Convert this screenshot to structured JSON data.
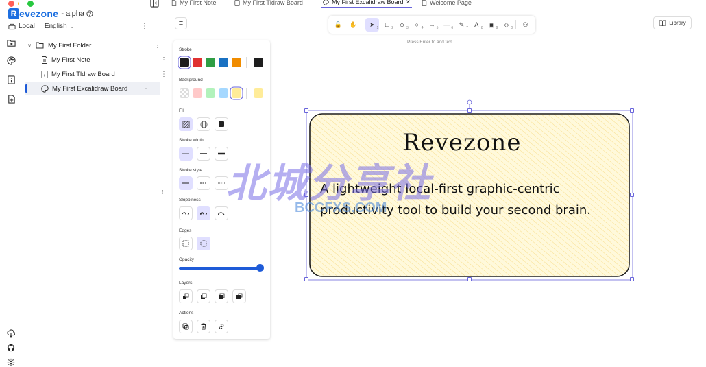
{
  "app": {
    "logo_letter": "R",
    "name": "evezone",
    "badge": "- alpha",
    "storage": "Local",
    "language": "English"
  },
  "sidebar": {
    "folder": "My First Folder",
    "items": [
      {
        "label": "My First Note",
        "icon": "note-icon"
      },
      {
        "label": "My First Tldraw Board",
        "icon": "board-icon"
      },
      {
        "label": "My First Excalidraw Board",
        "icon": "palette-icon",
        "active": true
      }
    ]
  },
  "tabs": [
    {
      "label": "My First Note"
    },
    {
      "label": "My First Tldraw Board"
    },
    {
      "label": "My First Excalidraw Board",
      "active": true,
      "close": "×"
    },
    {
      "label": "Welcome Page"
    }
  ],
  "toolbar": {
    "tools": [
      {
        "name": "lock",
        "glyph": "🔓",
        "key": ""
      },
      {
        "name": "hand",
        "glyph": "✋",
        "key": ""
      },
      {
        "name": "selection",
        "glyph": "➤",
        "key": "1",
        "selected": true
      },
      {
        "name": "rectangle",
        "glyph": "□",
        "key": "2"
      },
      {
        "name": "diamond",
        "glyph": "◇",
        "key": "3"
      },
      {
        "name": "ellipse",
        "glyph": "○",
        "key": "4"
      },
      {
        "name": "arrow",
        "glyph": "→",
        "key": "5"
      },
      {
        "name": "line",
        "glyph": "—",
        "key": "6"
      },
      {
        "name": "draw",
        "glyph": "✎",
        "key": "7"
      },
      {
        "name": "text",
        "glyph": "A",
        "key": "8"
      },
      {
        "name": "image",
        "glyph": "▣",
        "key": "9"
      },
      {
        "name": "eraser",
        "glyph": "◇",
        "key": "0"
      },
      {
        "name": "more",
        "glyph": "⚇",
        "key": ""
      }
    ],
    "hint": "Press Enter to add text",
    "library": "Library"
  },
  "properties": {
    "stroke_label": "Stroke",
    "stroke_colors": [
      "#1e1e1e",
      "#e03131",
      "#2f9e44",
      "#1971c2",
      "#f08c00"
    ],
    "stroke_current": "#1e1e1e",
    "background_label": "Background",
    "background_colors": [
      "transparent",
      "#ffc9c9",
      "#b2f2bb",
      "#a5d8ff",
      "#ffec99"
    ],
    "background_current": "#ffec99",
    "fill_label": "Fill",
    "stroke_width_label": "Stroke width",
    "stroke_style_label": "Stroke style",
    "sloppiness_label": "Sloppiness",
    "edges_label": "Edges",
    "opacity_label": "Opacity",
    "opacity_value": 100,
    "layers_label": "Layers",
    "actions_label": "Actions"
  },
  "card": {
    "title": "Revezone",
    "subtitle": "A lightweight local-first graphic-centric productivity tool to build your second brain.",
    "background": "#fff9db"
  },
  "watermark": {
    "main": "北城分享社",
    "sub": "BCCFXS.COM"
  }
}
